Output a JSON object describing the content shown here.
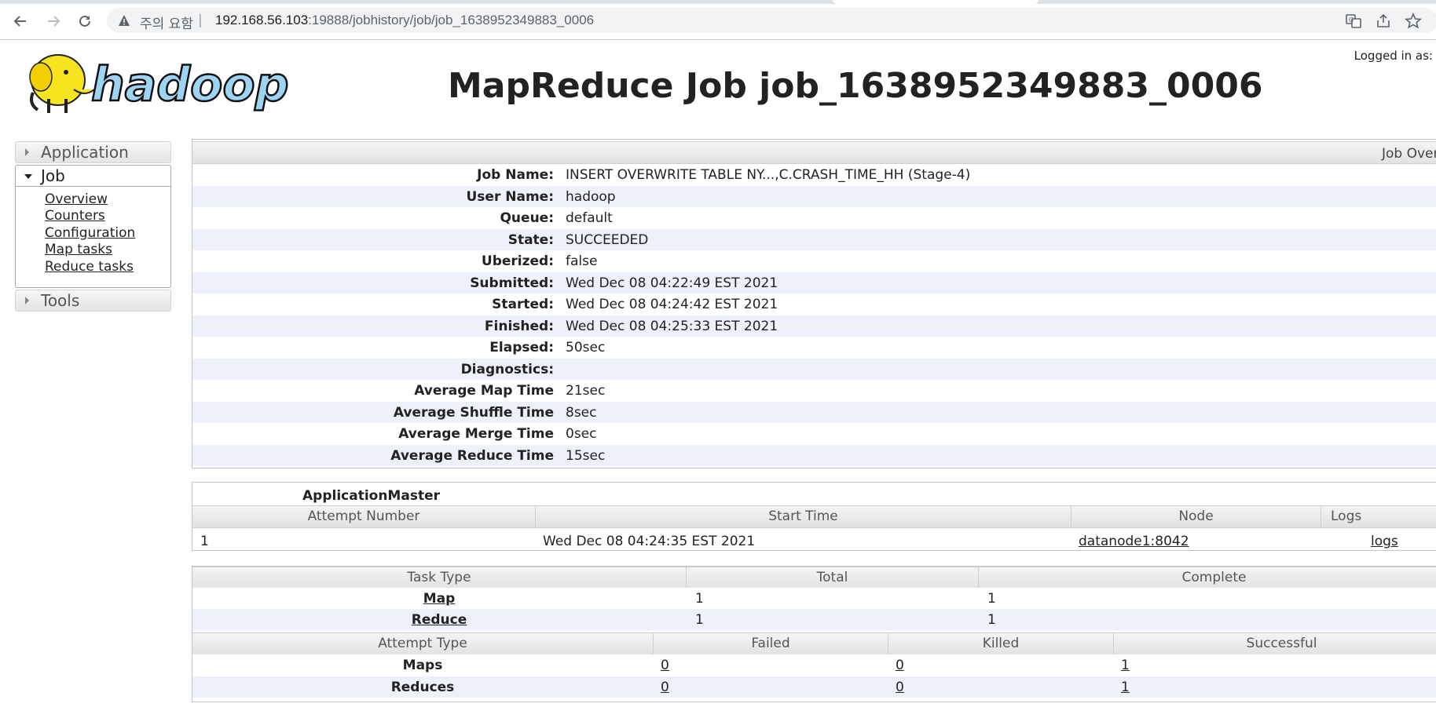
{
  "browser": {
    "security_warning": "주의 요함",
    "url_host": "192.168.56.103",
    "url_rest": ":19888/jobhistory/job/job_1638952349883_0006"
  },
  "header": {
    "logo_text": "hadoop",
    "title": "MapReduce Job job_1638952349883_0006",
    "logged_in": "Logged in as:"
  },
  "sidebar": {
    "application_label": "Application",
    "job_label": "Job",
    "job_links": [
      "Overview",
      "Counters",
      "Configuration",
      "Map tasks",
      "Reduce tasks"
    ],
    "tools_label": "Tools"
  },
  "overview": {
    "heading": "Job Overview",
    "rows": [
      {
        "k": "Job Name:",
        "v": "INSERT OVERWRITE TABLE NY...,C.CRASH_TIME_HH (Stage-4)"
      },
      {
        "k": "User Name:",
        "v": "hadoop"
      },
      {
        "k": "Queue:",
        "v": "default"
      },
      {
        "k": "State:",
        "v": "SUCCEEDED"
      },
      {
        "k": "Uberized:",
        "v": "false"
      },
      {
        "k": "Submitted:",
        "v": "Wed Dec 08 04:22:49 EST 2021"
      },
      {
        "k": "Started:",
        "v": "Wed Dec 08 04:24:42 EST 2021"
      },
      {
        "k": "Finished:",
        "v": "Wed Dec 08 04:25:33 EST 2021"
      },
      {
        "k": "Elapsed:",
        "v": "50sec"
      },
      {
        "k": "Diagnostics:",
        "v": ""
      },
      {
        "k": "Average Map Time",
        "v": "21sec"
      },
      {
        "k": "Average Shuffle Time",
        "v": "8sec"
      },
      {
        "k": "Average Merge Time",
        "v": "0sec"
      },
      {
        "k": "Average Reduce Time",
        "v": "15sec"
      }
    ]
  },
  "app_master": {
    "caption": "ApplicationMaster",
    "headers": [
      "Attempt Number",
      "Start Time",
      "Node",
      "Logs"
    ],
    "row": {
      "attempt": "1",
      "start": "Wed Dec 08 04:24:35 EST 2021",
      "node": "datanode1:8042",
      "logs": "logs"
    }
  },
  "tasks": {
    "headers": [
      "Task Type",
      "Total",
      "Complete"
    ],
    "rows": [
      {
        "type": "Map",
        "total": "1",
        "complete": "1"
      },
      {
        "type": "Reduce",
        "total": "1",
        "complete": "1"
      }
    ],
    "attempt_headers": [
      "Attempt Type",
      "Failed",
      "Killed",
      "Successful"
    ],
    "attempt_rows": [
      {
        "type": "Maps",
        "failed": "0",
        "killed": "0",
        "successful": "1"
      },
      {
        "type": "Reduces",
        "failed": "0",
        "killed": "0",
        "successful": "1"
      }
    ]
  }
}
